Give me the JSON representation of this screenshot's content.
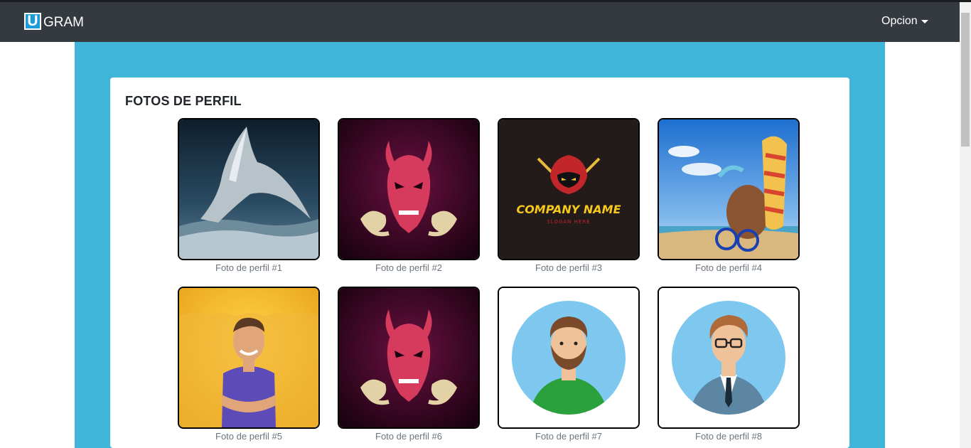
{
  "navbar": {
    "logo_letter": "U",
    "brand_text": "GRAM",
    "dropdown_label": "Opcion"
  },
  "main": {
    "title": "FOTOS DE PERFIL",
    "photos": [
      {
        "caption": "Foto de perfil #1",
        "image": "whale-tail-photo"
      },
      {
        "caption": "Foto de perfil #2",
        "image": "red-demon-mask-logo"
      },
      {
        "caption": "Foto de perfil #3",
        "image": "ninja-company-logo",
        "logo_text": "COMPANY NAME",
        "logo_slogan": "SLOGAN HERE"
      },
      {
        "caption": "Foto de perfil #4",
        "image": "beach-coconut-sandals-photo"
      },
      {
        "caption": "Foto de perfil #5",
        "image": "cartoon-man-yellow-background"
      },
      {
        "caption": "Foto de perfil #6",
        "image": "red-demon-mask-logo"
      },
      {
        "caption": "Foto de perfil #7",
        "image": "bearded-man-avatar"
      },
      {
        "caption": "Foto de perfil #8",
        "image": "businessman-avatar"
      }
    ]
  },
  "colors": {
    "navbar": "#343a40",
    "accent_blue": "#3fb5d9",
    "caption": "#6c757d"
  }
}
